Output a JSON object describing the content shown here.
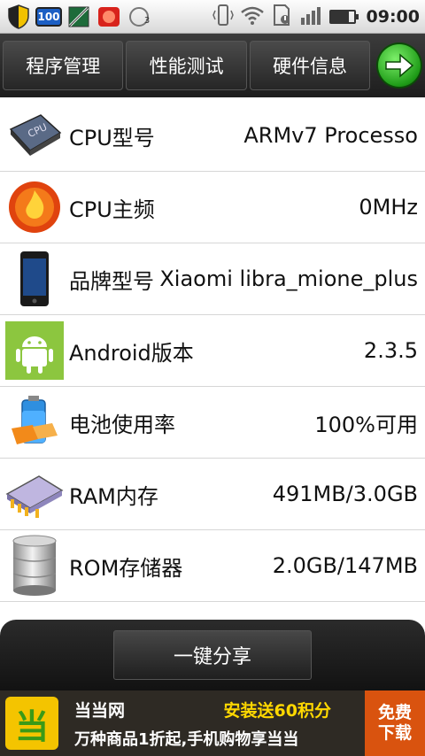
{
  "status_bar": {
    "battery_badge": "100",
    "notification_count": "3",
    "time": "09:00",
    "battery_level_pct": 80
  },
  "tabs": [
    {
      "label": "程序管理"
    },
    {
      "label": "性能测试"
    },
    {
      "label": "硬件信息"
    }
  ],
  "rows": [
    {
      "icon": "cpu-chip-icon",
      "label": "CPU型号",
      "value": "ARMv7 Processo"
    },
    {
      "icon": "cpu-frequency-flame-icon",
      "label": "CPU主频",
      "value": "0MHz"
    },
    {
      "icon": "phone-icon",
      "label": "品牌型号",
      "value": "Xiaomi libra_mione_plus"
    },
    {
      "icon": "android-icon",
      "label": "Android版本",
      "value": "2.3.5"
    },
    {
      "icon": "battery-icon",
      "label": "电池使用率",
      "value": "100%可用"
    },
    {
      "icon": "ram-chip-icon",
      "label": "RAM内存",
      "value": "491MB/3.0GB"
    },
    {
      "icon": "rom-storage-icon",
      "label": "ROM存储器",
      "value": "2.0GB/147MB"
    }
  ],
  "share_button": {
    "label": "一键分享"
  },
  "ad": {
    "logo_char": "当",
    "name": "当当网",
    "promo": "安装送60积分",
    "tagline": "万种商品1折起,手机购物享当当",
    "badge_line1": "免费",
    "badge_line2": "下载"
  },
  "colors": {
    "accent_green": "#1f9c18",
    "ad_promo_yellow": "#ffd800",
    "ad_badge_orange": "#d9530f"
  }
}
